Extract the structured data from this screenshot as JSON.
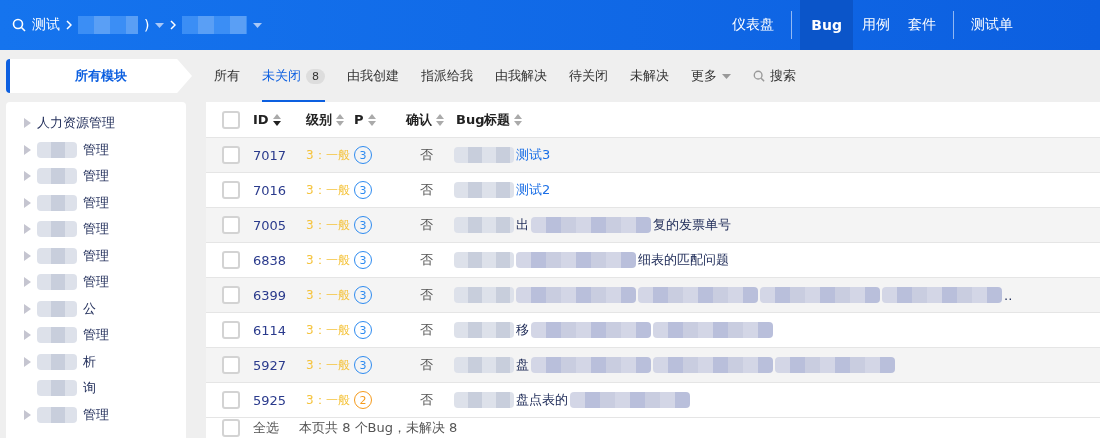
{
  "header": {
    "product": "测试",
    "crumb_fragment": ")",
    "nav": [
      {
        "label": "仪表盘",
        "selected": false,
        "divider_after": true
      },
      {
        "label": "Bug",
        "selected": true,
        "divider_after": false
      },
      {
        "label": "用例",
        "selected": false,
        "divider_after": false
      },
      {
        "label": "套件",
        "selected": false,
        "divider_after": true
      },
      {
        "label": "测试单",
        "selected": false,
        "divider_after": false
      }
    ]
  },
  "module_button": "所有模块",
  "tabs": [
    {
      "label": "所有",
      "selected": false,
      "dropdown": false
    },
    {
      "label": "未关闭",
      "selected": true,
      "count": "8",
      "dropdown": false
    },
    {
      "label": "由我创建",
      "selected": false,
      "dropdown": false
    },
    {
      "label": "指派给我",
      "selected": false,
      "dropdown": false
    },
    {
      "label": "由我解决",
      "selected": false,
      "dropdown": false
    },
    {
      "label": "待关闭",
      "selected": false,
      "dropdown": false
    },
    {
      "label": "未解决",
      "selected": false,
      "dropdown": false
    },
    {
      "label": "更多",
      "selected": false,
      "dropdown": true
    }
  ],
  "search": "搜索",
  "sidebar": {
    "items": [
      {
        "label": "人力资源管理",
        "blurred": false,
        "has_children": true
      },
      {
        "label": "管理",
        "blurred": true,
        "has_children": true
      },
      {
        "label": "管理",
        "blurred": true,
        "has_children": true
      },
      {
        "label": "管理",
        "blurred": true,
        "has_children": true
      },
      {
        "label": "管理",
        "blurred": true,
        "has_children": true
      },
      {
        "label": "管理",
        "blurred": true,
        "has_children": true
      },
      {
        "label": "管理",
        "blurred": true,
        "has_children": true
      },
      {
        "label": "公",
        "blurred": true,
        "has_children": true
      },
      {
        "label": "管理",
        "blurred": true,
        "has_children": true
      },
      {
        "label": "析",
        "blurred": true,
        "has_children": true
      },
      {
        "label": "询",
        "blurred": true,
        "has_children": false
      },
      {
        "label": "管理",
        "blurred": true,
        "has_children": true
      }
    ]
  },
  "table": {
    "select_all_checked": false,
    "columns": [
      {
        "label": "ID",
        "sorted": true
      },
      {
        "label": "级别",
        "sorted": false
      },
      {
        "label": "P",
        "sorted": false
      },
      {
        "label": "确认",
        "sorted": false
      },
      {
        "label": "Bug标题",
        "sorted": false
      }
    ],
    "rows": [
      {
        "checked": false,
        "id": "7017",
        "severity": "3：一般",
        "priority": "3",
        "color": "#2e8bf0",
        "confirmed": "否",
        "title": [
          {
            "kind": "blur"
          },
          {
            "kind": "link",
            "text": "测试3"
          }
        ]
      },
      {
        "checked": false,
        "id": "7016",
        "severity": "3：一般",
        "priority": "3",
        "color": "#2e8bf0",
        "confirmed": "否",
        "title": [
          {
            "kind": "blur"
          },
          {
            "kind": "link",
            "text": "测试2"
          }
        ]
      },
      {
        "checked": false,
        "id": "7005",
        "severity": "3：一般",
        "priority": "3",
        "color": "#2e8bf0",
        "confirmed": "否",
        "title": [
          {
            "kind": "blur"
          },
          {
            "kind": "text",
            "text": "出"
          },
          {
            "kind": "blur"
          },
          {
            "kind": "text",
            "text": "复的发票单号"
          }
        ]
      },
      {
        "checked": false,
        "id": "6838",
        "severity": "3：一般",
        "priority": "3",
        "color": "#2e8bf0",
        "confirmed": "否",
        "title": [
          {
            "kind": "blur"
          },
          {
            "kind": "blur"
          },
          {
            "kind": "text",
            "text": "细表的匹配问题"
          }
        ]
      },
      {
        "checked": false,
        "id": "6399",
        "severity": "3：一般",
        "priority": "3",
        "color": "#2e8bf0",
        "confirmed": "否",
        "title": [
          {
            "kind": "blur"
          },
          {
            "kind": "blur"
          },
          {
            "kind": "blur"
          },
          {
            "kind": "blur"
          },
          {
            "kind": "blur"
          },
          {
            "kind": "text",
            "text": ".."
          }
        ]
      },
      {
        "checked": false,
        "id": "6114",
        "severity": "3：一般",
        "priority": "3",
        "color": "#2e8bf0",
        "confirmed": "否",
        "title": [
          {
            "kind": "blur"
          },
          {
            "kind": "text",
            "text": "移"
          },
          {
            "kind": "blur"
          },
          {
            "kind": "blur"
          }
        ]
      },
      {
        "checked": false,
        "id": "5927",
        "severity": "3：一般",
        "priority": "3",
        "color": "#2e8bf0",
        "confirmed": "否",
        "title": [
          {
            "kind": "blur"
          },
          {
            "kind": "text",
            "text": "盘"
          },
          {
            "kind": "blur"
          },
          {
            "kind": "blur"
          },
          {
            "kind": "blur"
          }
        ]
      },
      {
        "checked": false,
        "id": "5925",
        "severity": "3：一般",
        "priority": "2",
        "color": "#f59a1b",
        "confirmed": "否",
        "title": [
          {
            "kind": "blur"
          },
          {
            "kind": "text",
            "text": "盘点表的"
          },
          {
            "kind": "blur"
          }
        ]
      }
    ]
  },
  "footer": {
    "select_all": "全选",
    "summary": "本页共 8 个Bug，未解决 8"
  }
}
